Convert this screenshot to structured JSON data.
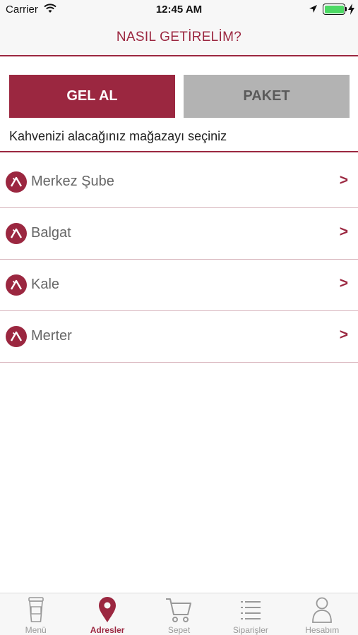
{
  "status_bar": {
    "carrier": "Carrier",
    "time": "12:45 AM",
    "battery_color": "#4cd964"
  },
  "header": {
    "title": "NASIL GETİRELİM?"
  },
  "order_type": {
    "gel_al_label": "GEL AL",
    "paket_label": "PAKET",
    "selected": "GEL AL"
  },
  "instruction": "Kahvenizi alacağınız mağazayı seçiniz",
  "stores": [
    {
      "name": "Merkez Şube",
      "chevron": ">"
    },
    {
      "name": "Balgat",
      "chevron": ">"
    },
    {
      "name": "Kale",
      "chevron": ">"
    },
    {
      "name": "Merter",
      "chevron": ">"
    }
  ],
  "tabs": [
    {
      "label": "Menü",
      "icon": "coffee-cup-icon"
    },
    {
      "label": "Adresler",
      "icon": "map-pin-icon",
      "active": true
    },
    {
      "label": "Sepet",
      "icon": "cart-icon"
    },
    {
      "label": "Siparişler",
      "icon": "list-icon"
    },
    {
      "label": "Hesabım",
      "icon": "user-icon"
    }
  ],
  "colors": {
    "brand": "#9b2740",
    "inactive_button": "#b3b3b3",
    "tab_inactive": "#999999"
  }
}
